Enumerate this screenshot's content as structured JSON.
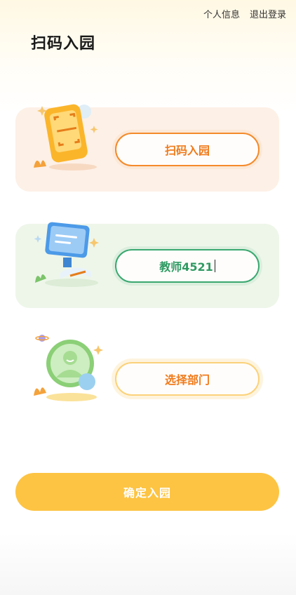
{
  "header": {
    "profile_link": "个人信息",
    "logout_link": "退出登录",
    "title": "扫码入园"
  },
  "cards": {
    "scan": {
      "button_label": "扫码入园"
    },
    "identity": {
      "input_value": "教师4521"
    },
    "department": {
      "button_label": "选择部门"
    }
  },
  "confirm": {
    "label": "确定入园"
  },
  "colors": {
    "accent_orange": "#f48a2a",
    "accent_green": "#3aa870",
    "confirm_yellow": "#fdc443"
  }
}
